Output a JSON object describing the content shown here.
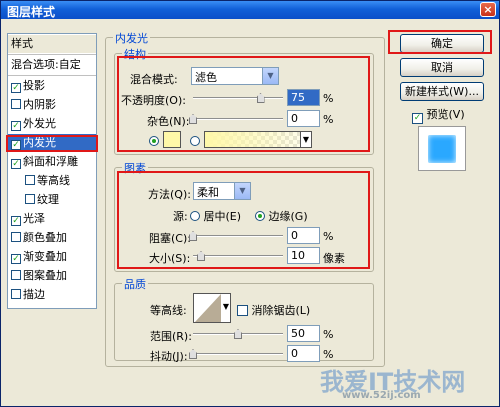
{
  "window": {
    "title": "图层样式",
    "close_label": "×"
  },
  "sidebar": {
    "header": "样式",
    "blend_options": "混合选项:自定",
    "items": [
      {
        "label": "投影",
        "checked": true
      },
      {
        "label": "内阴影",
        "checked": false
      },
      {
        "label": "外发光",
        "checked": true
      },
      {
        "label": "内发光",
        "checked": true,
        "selected": true
      },
      {
        "label": "斜面和浮雕",
        "checked": true
      },
      {
        "label": "等高线",
        "checked": false,
        "indent": true
      },
      {
        "label": "纹理",
        "checked": false,
        "indent": true
      },
      {
        "label": "光泽",
        "checked": true
      },
      {
        "label": "颜色叠加",
        "checked": false
      },
      {
        "label": "渐变叠加",
        "checked": true
      },
      {
        "label": "图案叠加",
        "checked": false
      },
      {
        "label": "描边",
        "checked": false
      }
    ]
  },
  "panel": {
    "title": "内发光",
    "structure": {
      "legend": "结构",
      "blend_mode_label": "混合模式:",
      "blend_mode_value": "滤色",
      "opacity_label": "不透明度(O):",
      "opacity_value": "75",
      "opacity_unit": "%",
      "opacity_fraction": 0.75,
      "noise_label": "杂色(N):",
      "noise_value": "0",
      "noise_unit": "%",
      "color_swatch": "#fff8a8"
    },
    "elements": {
      "legend": "图素",
      "method_label": "方法(Q):",
      "method_value": "柔和",
      "source_label": "源:",
      "source_center": "居中(E)",
      "source_edge": "边缘(G)",
      "choke_label": "阻塞(C):",
      "choke_value": "0",
      "choke_unit": "%",
      "size_label": "大小(S):",
      "size_value": "10",
      "size_unit": "像素"
    },
    "quality": {
      "legend": "品质",
      "contour_label": "等高线:",
      "antialias_label": "消除锯齿(L)",
      "range_label": "范围(R):",
      "range_value": "50",
      "range_unit": "%",
      "jitter_label": "抖动(J):",
      "jitter_value": "0",
      "jitter_unit": "%"
    }
  },
  "buttons": {
    "ok": "确定",
    "cancel": "取消",
    "new_style": "新建样式(W)...",
    "preview": "预览(V)"
  },
  "preview_color": "#2aa8ff",
  "watermark": {
    "text": "我爱IT技术网",
    "url": "www.52ij.com"
  }
}
